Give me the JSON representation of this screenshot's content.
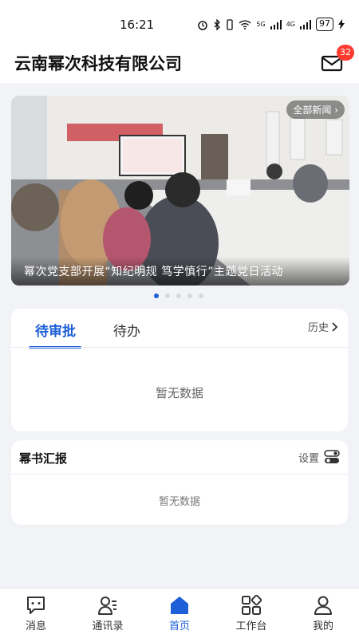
{
  "status_bar": {
    "time": "16:21",
    "signal_labels": [
      "5G",
      "4G"
    ],
    "battery": "97"
  },
  "header": {
    "title": "云南幂次科技有限公司",
    "mail_icon": "mail-icon",
    "unread_count": "32"
  },
  "banner": {
    "all_news_label": "全部新闻",
    "caption": "幂次党支部开展“知纪明规 笃学慎行”主题党日活动",
    "slide_count": 5,
    "active_slide": 1
  },
  "approval": {
    "tabs": [
      {
        "label": "待审批",
        "active": true
      },
      {
        "label": "待办",
        "active": false
      }
    ],
    "history_label": "历史",
    "empty_text": "暂无数据"
  },
  "report": {
    "title": "幂书汇报",
    "settings_label": "设置",
    "empty_text": "暂无数据"
  },
  "bottom_nav": {
    "items": [
      {
        "label": "消息",
        "icon": "message-icon",
        "active": false
      },
      {
        "label": "通讯录",
        "icon": "contacts-icon",
        "active": false
      },
      {
        "label": "首页",
        "icon": "home-icon",
        "active": true
      },
      {
        "label": "工作台",
        "icon": "workbench-icon",
        "active": false
      },
      {
        "label": "我的",
        "icon": "profile-icon",
        "active": false
      }
    ]
  },
  "colors": {
    "accent": "#1d5fd6",
    "badge": "#ff3b30",
    "background": "#f2f3f7"
  }
}
